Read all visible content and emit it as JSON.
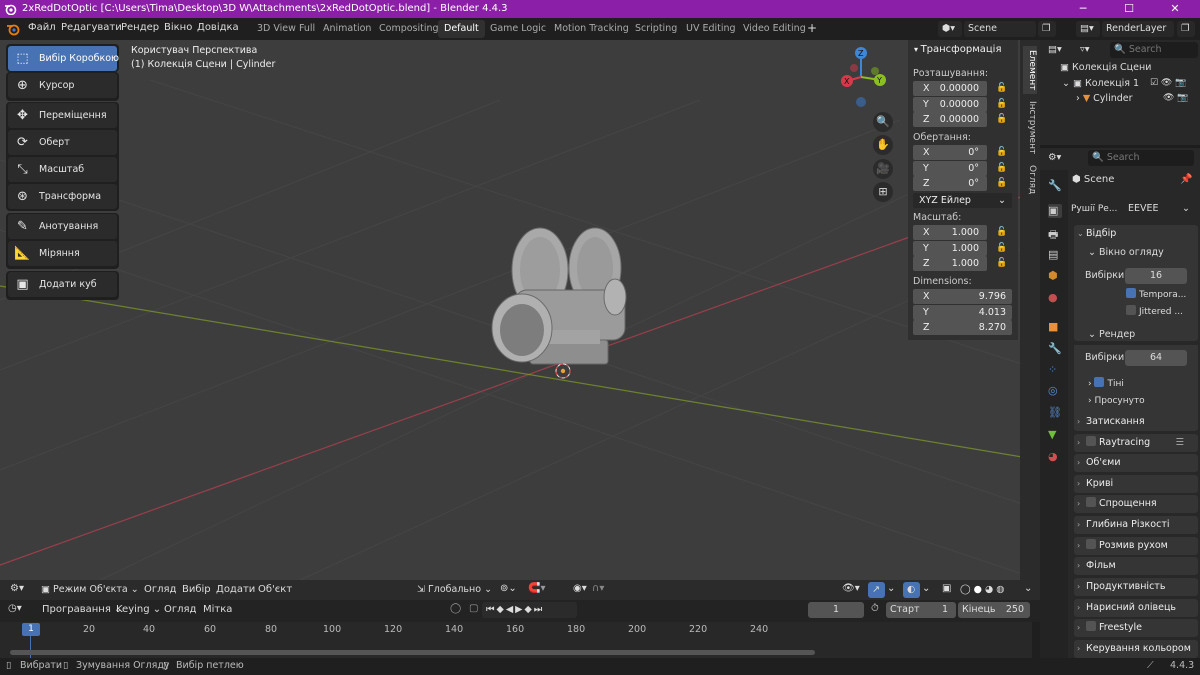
{
  "window": {
    "title": "2xRedDotOptic [C:\\Users\\Tima\\Desktop\\3D W\\Attachments\\2xRedDotOptic.blend] - Blender 4.4.3",
    "minimize": "─",
    "maximize": "☐",
    "close": "✕"
  },
  "menu": {
    "file": "Файл",
    "edit": "Редагувати",
    "render": "Рендер",
    "window": "Вікно",
    "help": "Довідка"
  },
  "workspaces": [
    "3D View Full",
    "Animation",
    "Compositing",
    "Default",
    "Game Logic",
    "Motion Tracking",
    "Scripting",
    "UV Editing",
    "Video Editing"
  ],
  "workspace_add": "+",
  "scene": {
    "label": "Scene",
    "render_layer": "RenderLayer"
  },
  "tools": {
    "select_box": "Вибір Коробкою",
    "cursor": "Курсор",
    "move": "Переміщення",
    "rotate": "Оберт",
    "scale": "Масштаб",
    "transform": "Трансформа",
    "annotate": "Анотування",
    "measure": "Міряння",
    "add_cube": "Додати куб"
  },
  "viewport": {
    "view_name": "Користувач Перспектива",
    "collection_info": "(1) Колекція Сцени | Cylinder",
    "gizmo": {
      "x": "X",
      "y": "Y",
      "z": "Z"
    }
  },
  "npanel": {
    "header": "Трансформація",
    "location_label": "Розташування:",
    "location": {
      "x": "0.00000",
      "y": "0.00000",
      "z": "0.00000"
    },
    "rotation_label": "Обертання:",
    "rotation": {
      "x": "0°",
      "y": "0°",
      "z": "0°"
    },
    "rotation_mode": "XYZ Ейлер",
    "scale_label": "Масштаб:",
    "scale": {
      "x": "1.000",
      "y": "1.000",
      "z": "1.000"
    },
    "dimensions_label": "Dimensions:",
    "dimensions": {
      "x": "9.796",
      "y": "4.013",
      "z": "8.270"
    },
    "tabs": [
      "Елемент",
      "Інструмент",
      "Огляд"
    ]
  },
  "viewport_header": {
    "mode": "Режим Об'єкта",
    "view": "Огляд",
    "select": "Вибір",
    "add": "Додати",
    "object": "Об'єкт",
    "orientation": "Глобально"
  },
  "timeline": {
    "playback": "Програвання",
    "keying": "Keying",
    "view": "Огляд",
    "marker": "Мітка",
    "current_frame": "1",
    "start_label": "Старт",
    "start": "1",
    "end_label": "Кінець",
    "end": "250",
    "ticks": [
      "1",
      "20",
      "40",
      "60",
      "80",
      "100",
      "120",
      "140",
      "160",
      "180",
      "200",
      "220",
      "240"
    ]
  },
  "status": {
    "select": "Вибрати",
    "zoom": "Зумування Огляду",
    "loop_select": "Вибір петлею",
    "version": "4.4.3"
  },
  "outliner": {
    "search_placeholder": "Search",
    "root": "Колекція Сцени",
    "collection": "Колекція 1",
    "object": "Cylinder"
  },
  "properties": {
    "search_placeholder": "Search",
    "scene": "Scene",
    "render_engine_label": "Рушії Ре...",
    "render_engine": "EEVEE",
    "sampling": "Відбір",
    "viewport": "Вікно огляду",
    "samples_label": "Вибірки",
    "viewport_samples": "16",
    "temporal": "Tempora...",
    "jittered": "Jittered ...",
    "render": "Рендер",
    "render_samples": "64",
    "shadows": "Тіні",
    "advanced": "Просунуто",
    "clamping": "Затискання",
    "raytracing": "Raytracing",
    "volumes": "Об'єми",
    "curves": "Криві",
    "simplify": "Спрощення",
    "dof": "Глибина Різкості",
    "motion_blur": "Розмив рухом",
    "film": "Фільм",
    "performance": "Продуктивність",
    "grease_pencil": "Нарисний олівець",
    "freestyle": "Freestyle",
    "color_management": "Керування кольором"
  },
  "colors": {
    "title_bar": "#8c1fa8",
    "active_tool": "#4772b3",
    "viewport_bg": "#3d3d3d",
    "x_axis": "#d63a4a",
    "y_axis": "#8bbd24",
    "z_axis": "#3e86d6"
  }
}
